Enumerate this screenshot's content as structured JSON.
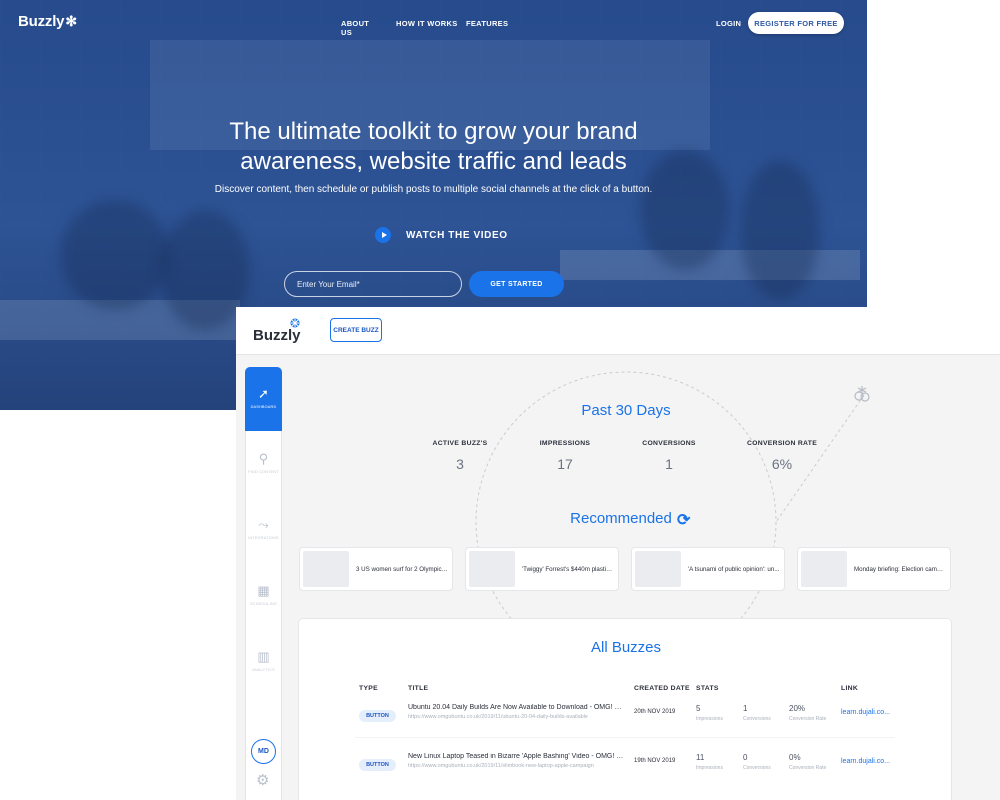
{
  "hero": {
    "logo": "Buzzly",
    "nav": [
      "ABOUT US",
      "HOW IT WORKS",
      "FEATURES"
    ],
    "login": "LOGIN",
    "register": "REGISTER FOR FREE",
    "title_line1": "The ultimate toolkit to grow your brand",
    "title_line2": "awareness, website traffic and leads",
    "subtitle": "Discover content, then schedule or publish posts to multiple social channels at the click of a button.",
    "watch_video": "WATCH THE VIDEO",
    "email_placeholder": "Enter Your Email*",
    "get_started": "GET STARTED"
  },
  "app": {
    "logo": "Buzzly",
    "create_buzz": "CREATE BUZZ",
    "sidebar": [
      {
        "label": "DASHBOARD",
        "icon": "arrow-icon",
        "active": true
      },
      {
        "label": "FIND CONTENT",
        "icon": "search-icon",
        "active": false
      },
      {
        "label": "INTEGRATIONS",
        "icon": "integrations-icon",
        "active": false
      },
      {
        "label": "SCHEDULING",
        "icon": "calendar-icon",
        "active": false
      },
      {
        "label": "ANALYTICS",
        "icon": "bar-chart-icon",
        "active": false
      }
    ],
    "avatar_initials": "MD",
    "period_title": "Past 30 Days",
    "stats": [
      {
        "label": "ACTIVE BUZZ'S",
        "value": "3"
      },
      {
        "label": "IMPRESSIONS",
        "value": "17"
      },
      {
        "label": "CONVERSIONS",
        "value": "1"
      },
      {
        "label": "CONVERSION RATE",
        "value": "6%"
      }
    ],
    "recommended_title": "Recommended",
    "recommended": [
      "3 US women surf for 2 Olympic b...",
      "'Twiggy' Forrest's $440m plastics...",
      "'A tsunami of public opinion': un...",
      "Monday briefing: Election campa..."
    ],
    "all_buzzes_title": "All Buzzes",
    "columns": [
      "TYPE",
      "TITLE",
      "CREATED DATE",
      "STATS",
      "LINK"
    ],
    "buzzes": [
      {
        "type": "BUTTON",
        "title": "Ubuntu 20.04 Daily Builds Are Now Available to Download - OMG! Ub...",
        "url": "https://www.omgubuntu.co.uk/2019/11/ubuntu-20-04-daily-builds-available",
        "created": "20th NOV 2019",
        "impressions": "5",
        "impressions_label": "Impressions",
        "conversions": "1",
        "conversions_label": "Conversions",
        "rate": "20%",
        "rate_label": "Conversion Rate",
        "link": "learn.dujali.co..."
      },
      {
        "type": "BUTTON",
        "title": "New Linux Laptop Teased in Bizarre 'Apple Bashing' Video - OMG! Ub...",
        "url": "https://www.omgubuntu.co.uk/2019/11/slimbook-new-laptop-apple-campaign",
        "created": "19th NOV 2019",
        "impressions": "11",
        "impressions_label": "Impressions",
        "conversions": "0",
        "conversions_label": "Conversions",
        "rate": "0%",
        "rate_label": "Conversion Rate",
        "link": "learn.dujali.co..."
      }
    ]
  },
  "colors": {
    "hero_blue": "#2a4f8c",
    "accent": "#1a73e8",
    "app_bg": "#f4f4f5"
  }
}
